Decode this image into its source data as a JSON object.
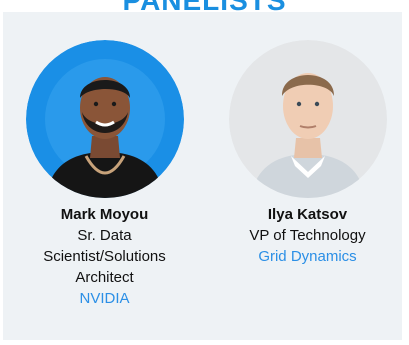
{
  "section": {
    "title": "PANELISTS"
  },
  "panelists": [
    {
      "name": "Mark Moyou",
      "role": "Sr. Data Scientist/Solutions Architect",
      "company": "NVIDIA",
      "avatar_icon": "person-photo-icon",
      "avatar_bg": "#1a8fe6"
    },
    {
      "name": "Ilya Katsov",
      "role": "VP of Technology",
      "company": "Grid Dynamics",
      "avatar_icon": "person-photo-icon",
      "avatar_bg": "#e4e6e8"
    }
  ],
  "colors": {
    "accent": "#1a8fe0",
    "link": "#2b8fe6",
    "panel_bg": "#eef2f5"
  }
}
